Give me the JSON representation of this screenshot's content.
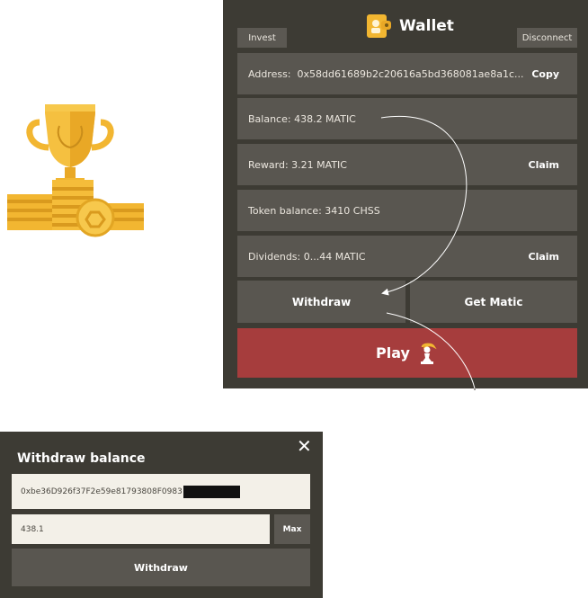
{
  "wallet": {
    "title": "Wallet",
    "invest_label": "Invest",
    "disconnect_label": "Disconnect",
    "address_label": "Address:",
    "address_value": "0x58dd61689b2c20616a5bd368081ae8a1c...",
    "copy_label": "Copy",
    "balance_text": "Balance: 438.2 MATIC",
    "reward_text": "Reward: 3.21 MATIC",
    "reward_claim_label": "Claim",
    "token_balance_text": "Token balance:  3410 CHSS",
    "dividends_text": "Dividends:  0...44 MATIC",
    "dividends_claim_label": "Claim",
    "withdraw_label": "Withdraw",
    "get_matic_label": "Get Matic",
    "play_label": "Play"
  },
  "modal": {
    "title": "Withdraw balance",
    "address_value": "0xbe36D926f37F2e59e81793808F0983",
    "amount_value": "438.1",
    "max_label": "Max",
    "withdraw_label": "Withdraw"
  },
  "colors": {
    "panel": "#3d3b34",
    "row": "#595650",
    "play": "#a63d3d",
    "gold": "#f2b631"
  }
}
